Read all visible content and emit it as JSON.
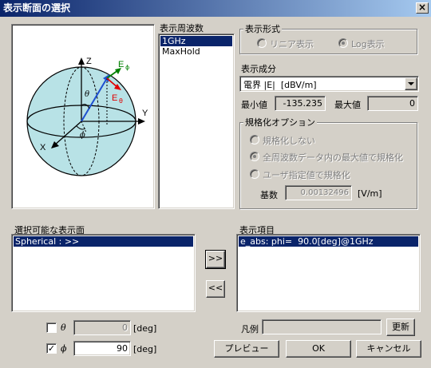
{
  "window": {
    "title": "表示断面の選択",
    "close_label": "×"
  },
  "freq": {
    "label": "表示周波数",
    "items": [
      "1GHz",
      "MaxHold"
    ]
  },
  "format": {
    "label": "表示形式",
    "linear_label": "リニア表示",
    "log_label": "Log表示"
  },
  "component": {
    "label": "表示成分",
    "selected": "電界 |E|  [dBV/m]",
    "min_label": "最小値",
    "min_value": "-135.235",
    "max_label": "最大値",
    "max_value": "0"
  },
  "normalize": {
    "label": "規格化オプション",
    "opt_none": "規格化しない",
    "opt_max": "全周波数データ内の最大値で規格化",
    "opt_user": "ユーザ指定値で規格化",
    "base_label": "基数",
    "base_value": "0.00132496",
    "base_unit": "[V/m]"
  },
  "surfaces": {
    "label": "選択可能な表示面",
    "items": [
      "Spherical : >>"
    ]
  },
  "display_items": {
    "label": "表示項目",
    "items": [
      "e_abs: phi=  90.0[deg]@1GHz"
    ]
  },
  "move": {
    "add_label": ">>",
    "remove_label": "<<"
  },
  "theta": {
    "symbol": "θ",
    "value": "0",
    "unit": "[deg]",
    "checked": false
  },
  "phi": {
    "symbol": "ϕ",
    "value": "90",
    "unit": "[deg]",
    "checked": true,
    "check_mark": "✓"
  },
  "legend": {
    "label": "凡例",
    "value": "",
    "update_label": "更新"
  },
  "buttons": {
    "preview": "プレビュー",
    "ok": "OK",
    "cancel": "キャンセル"
  },
  "diagram": {
    "axis_z": "Z",
    "axis_y": "Y",
    "axis_x": "X",
    "e_phi": "E",
    "e_phi_sub": "ϕ",
    "e_theta": "E",
    "e_theta_sub": "θ",
    "theta_sym": "θ",
    "phi_sym": "ϕ",
    "sphere_color": "#b8e2e6",
    "e_phi_color": "#008000",
    "e_theta_color": "#e00000",
    "vector_color": "#1e50d0"
  }
}
